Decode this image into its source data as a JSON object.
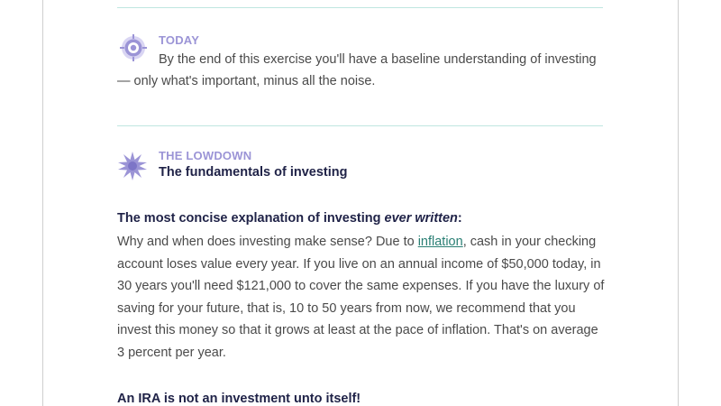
{
  "today": {
    "eyebrow": "TODAY",
    "text": "By the end of this exercise you'll have a baseline understanding of investing — only what's important, minus all the noise."
  },
  "lowdown": {
    "eyebrow": "THE LOWDOWN",
    "subtitle": "The fundamentals of investing"
  },
  "concise": {
    "heading_pre": "The most concise explanation of investing ",
    "heading_em": "ever written",
    "heading_post": ":",
    "body_pre": "Why and when does investing make sense? Due to ",
    "link": "inflation",
    "body_post": ", cash in your checking account loses value every year. If you live on an annual income of $50,000 today, in 30 years you'll need $121,000 to cover the same expenses. If you have the luxury of saving for your future, that is, 10 to 50 years from now, we recommend that you invest this money so that it grows at least at the pace of inflation. That's on average 3 percent per year."
  },
  "ira": {
    "heading": "An IRA is not an investment unto itself!"
  },
  "colors": {
    "accent": "#9b94d6",
    "heading": "#1f2247",
    "link": "#2a7f74",
    "divider": "#bfe6e0"
  },
  "icons": {
    "today": "target-icon",
    "lowdown": "starburst-icon"
  }
}
